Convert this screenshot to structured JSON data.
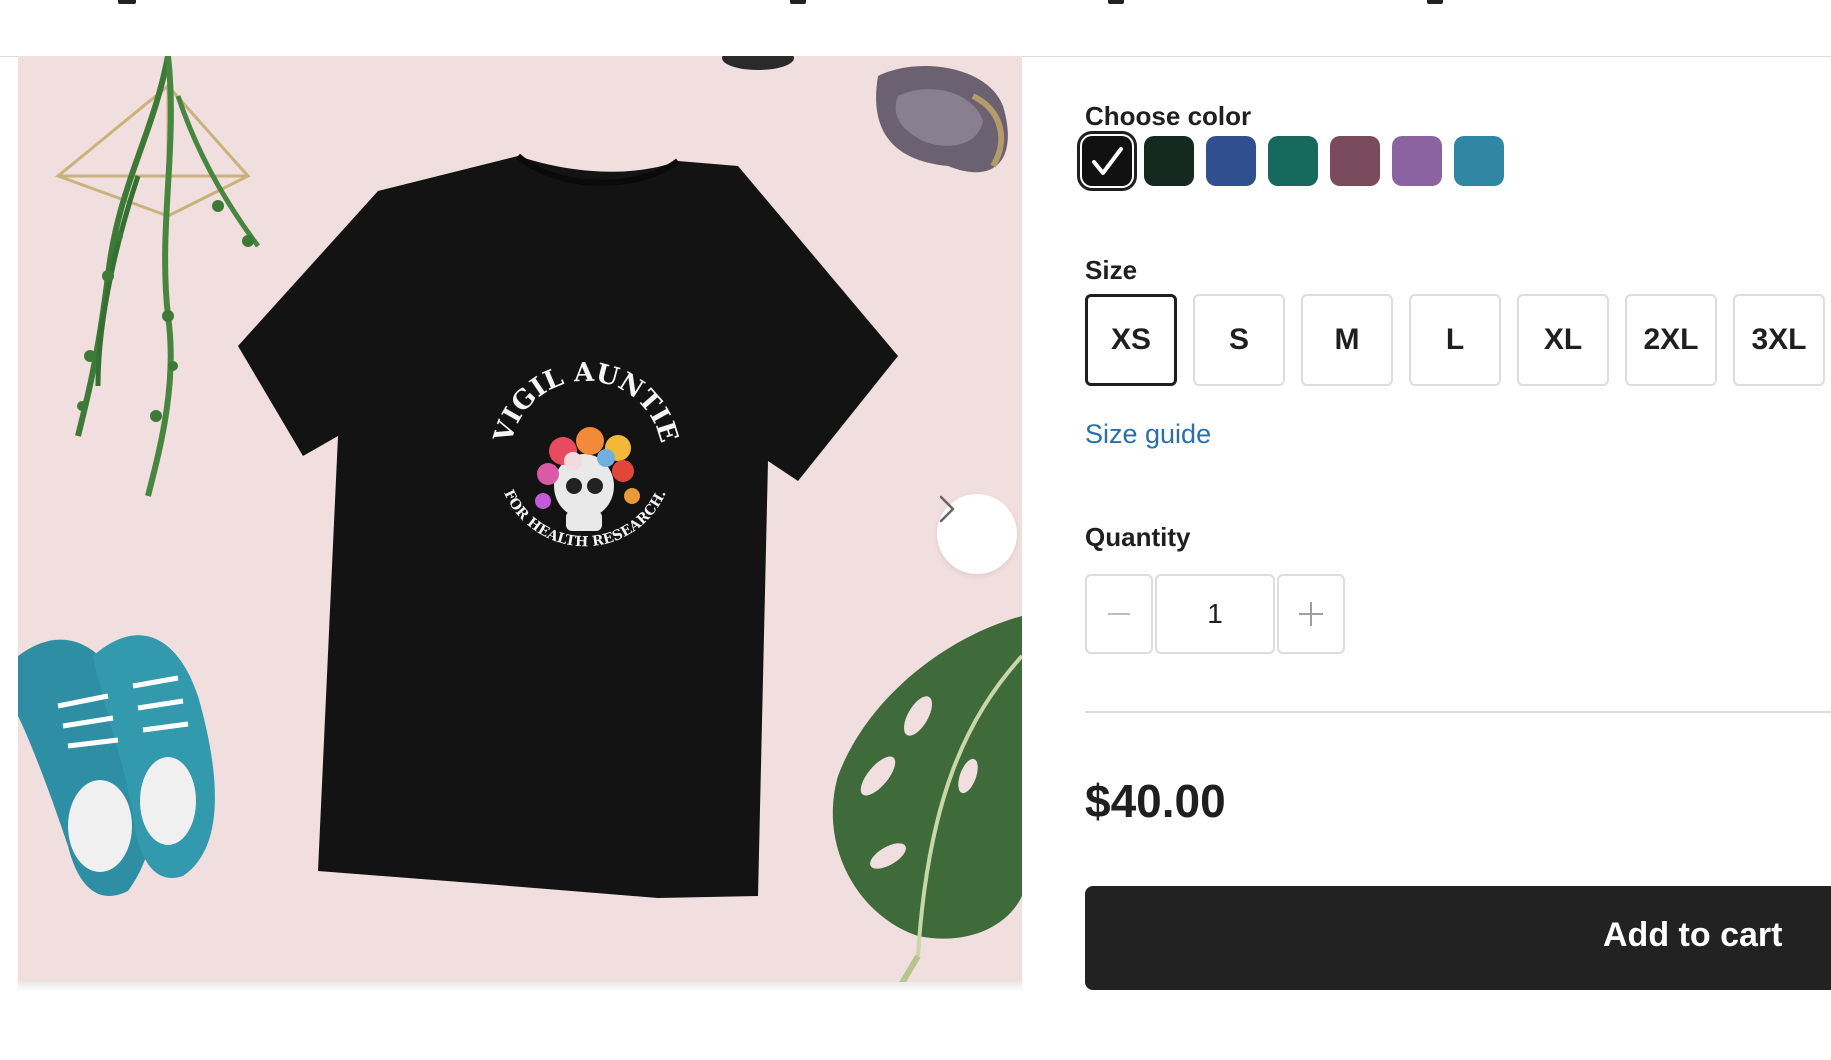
{
  "product_options": {
    "color": {
      "label": "Choose color",
      "swatches": [
        {
          "name": "black",
          "hex": "#111111",
          "selected": true
        },
        {
          "name": "dark-green",
          "hex": "#14291f",
          "selected": false
        },
        {
          "name": "blue",
          "hex": "#2f4f8f",
          "selected": false
        },
        {
          "name": "teal",
          "hex": "#17695e",
          "selected": false
        },
        {
          "name": "mauve",
          "hex": "#7a4b5c",
          "selected": false
        },
        {
          "name": "purple",
          "hex": "#8a63a0",
          "selected": false
        },
        {
          "name": "ocean",
          "hex": "#2f87a3",
          "selected": false
        }
      ]
    },
    "size": {
      "label": "Size",
      "options": [
        "XS",
        "S",
        "M",
        "L",
        "XL",
        "2XL",
        "3XL"
      ],
      "selected": "XS"
    },
    "size_guide_link": "Size guide",
    "quantity": {
      "label": "Quantity",
      "value": "1",
      "decrement_icon": "minus-icon",
      "increment_icon": "plus-icon"
    }
  },
  "price": "$40.00",
  "add_to_cart_label": "Add to cart",
  "gallery": {
    "next_icon": "chevron-right-icon",
    "shirt_graphic": {
      "arc_top_text": "VIGIL AUNTIE",
      "arc_bottom_text": "FOR HEALTH RESEARCH.",
      "shirt_color": "#131313",
      "background_color": "#f1dede"
    }
  },
  "colors": {
    "accent_link": "#2a6fa8",
    "button_dark": "#222222",
    "border": "#dcdcdc"
  }
}
